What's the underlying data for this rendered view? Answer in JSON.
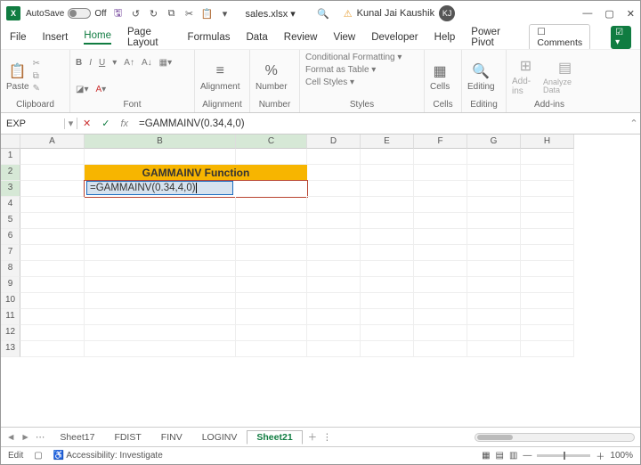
{
  "titlebar": {
    "autosave": "AutoSave",
    "autosave_off": "Off",
    "filename": "sales.xlsx ▾",
    "user": "Kunal Jai Kaushik",
    "avatar": "KJ"
  },
  "menu": {
    "file": "File",
    "insert": "Insert",
    "home": "Home",
    "page_layout": "Page Layout",
    "formulas": "Formulas",
    "data": "Data",
    "review": "Review",
    "view": "View",
    "developer": "Developer",
    "help": "Help",
    "power_pivot": "Power Pivot",
    "comments": "☐ Comments",
    "share": "☑ ▾"
  },
  "ribbon": {
    "clipboard": "Clipboard",
    "paste": "Paste",
    "font": "Font",
    "alignment": "Alignment",
    "align_btn": "Alignment",
    "number": "Number",
    "percent": "%",
    "num_btn": "Number",
    "styles": "Styles",
    "cond_fmt": "Conditional Formatting ▾",
    "fmt_table": "Format as Table ▾",
    "cell_styles": "Cell Styles ▾",
    "cells": "Cells",
    "cells_btn": "Cells",
    "editing": "Editing",
    "editing_btn": "Editing",
    "addins": "Add-ins",
    "addins_btn": "Add-ins",
    "analyze": "Analyze Data"
  },
  "fnbar": {
    "namebox": "EXP",
    "formula": "=GAMMAINV(0.34,4,0)"
  },
  "cols": [
    "",
    "A",
    "B",
    "C",
    "D",
    "E",
    "F",
    "G",
    "H"
  ],
  "rows": [
    "1",
    "2",
    "3",
    "4",
    "5",
    "6",
    "7",
    "8",
    "9",
    "10",
    "11",
    "12",
    "13"
  ],
  "sheet": {
    "title_cell": "GAMMAINV Function",
    "editing_cell": "=GAMMAINV(0.34,4,0)"
  },
  "tabs": [
    "Sheet17",
    "FDIST",
    "FINV",
    "LOGINV",
    "Sheet21"
  ],
  "active_tab": "Sheet21",
  "status": {
    "mode": "Edit",
    "access": "Accessibility: Investigate",
    "zoom": "100%"
  },
  "chart_data": null
}
